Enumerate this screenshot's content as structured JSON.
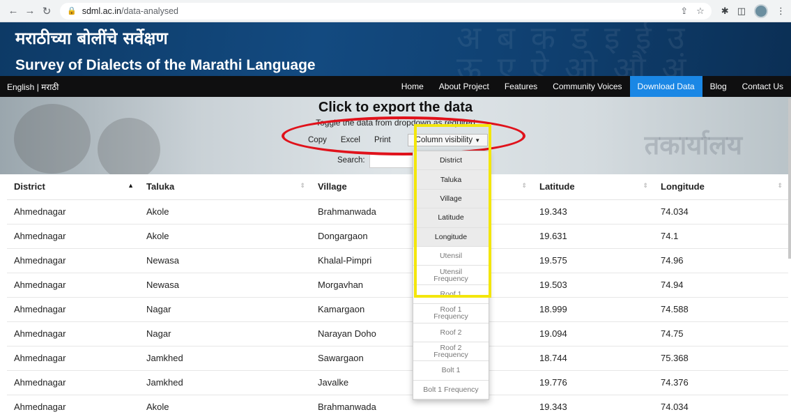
{
  "browser": {
    "url_host": "sdml.ac.in",
    "url_path": "/data-analysed"
  },
  "banner": {
    "title_mr": "मराठीच्या बोलींचे सर्वेक्षण",
    "title_en": "Survey of Dialects of the Marathi Language"
  },
  "nav": {
    "lang": "English | मराठी",
    "links": [
      "Home",
      "About Project",
      "Features",
      "Community Voices",
      "Download Data",
      "Blog",
      "Contact Us"
    ],
    "active": "Download Data"
  },
  "hero": {
    "heading": "Click to export the data",
    "subheading": "Toggle the data from dropdown as required",
    "buttons": [
      "Copy",
      "Excel",
      "Print"
    ],
    "column_visibility_label": "Column visibility",
    "search_label": "Search:",
    "search_value": ""
  },
  "table": {
    "headers": [
      "District",
      "Taluka",
      "Village",
      "",
      "Latitude",
      "Longitude"
    ],
    "rows": [
      [
        "Ahmednagar",
        "Akole",
        "Brahmanwada",
        "",
        "19.343",
        "74.034"
      ],
      [
        "Ahmednagar",
        "Akole",
        "Dongargaon",
        "",
        "19.631",
        "74.1"
      ],
      [
        "Ahmednagar",
        "Newasa",
        "Khalal-Pimpri",
        "",
        "19.575",
        "74.96"
      ],
      [
        "Ahmednagar",
        "Newasa",
        "Morgavhan",
        "",
        "19.503",
        "74.94"
      ],
      [
        "Ahmednagar",
        "Nagar",
        "Kamargaon",
        "",
        "18.999",
        "74.588"
      ],
      [
        "Ahmednagar",
        "Nagar",
        "Narayan Doho",
        "",
        "19.094",
        "74.75"
      ],
      [
        "Ahmednagar",
        "Jamkhed",
        "Sawargaon",
        "",
        "18.744",
        "75.368"
      ],
      [
        "Ahmednagar",
        "Jamkhed",
        "Javalke",
        "",
        "19.776",
        "74.376"
      ],
      [
        "Ahmednagar",
        "Akole",
        "Brahmanwada",
        "",
        "19.343",
        "74.034"
      ]
    ]
  },
  "dropdown": {
    "options": [
      {
        "label": "District",
        "sub": "",
        "active": true
      },
      {
        "label": "Taluka",
        "sub": "",
        "active": true
      },
      {
        "label": "Village",
        "sub": "",
        "active": true
      },
      {
        "label": "Latitude",
        "sub": "",
        "active": true
      },
      {
        "label": "Longitude",
        "sub": "",
        "active": true
      },
      {
        "label": "Utensil",
        "sub": "",
        "active": false
      },
      {
        "label": "Utensil",
        "sub": "Frequency",
        "active": false
      },
      {
        "label": "Roof 1",
        "sub": "",
        "active": false
      },
      {
        "label": "Roof 1",
        "sub": "Frequency",
        "active": false
      },
      {
        "label": "Roof 2",
        "sub": "",
        "active": false
      },
      {
        "label": "Roof 2",
        "sub": "Frequency",
        "active": false
      },
      {
        "label": "Bolt 1",
        "sub": "",
        "active": false
      },
      {
        "label": "Bolt 1 Frequency",
        "sub": "",
        "active": false
      }
    ]
  }
}
